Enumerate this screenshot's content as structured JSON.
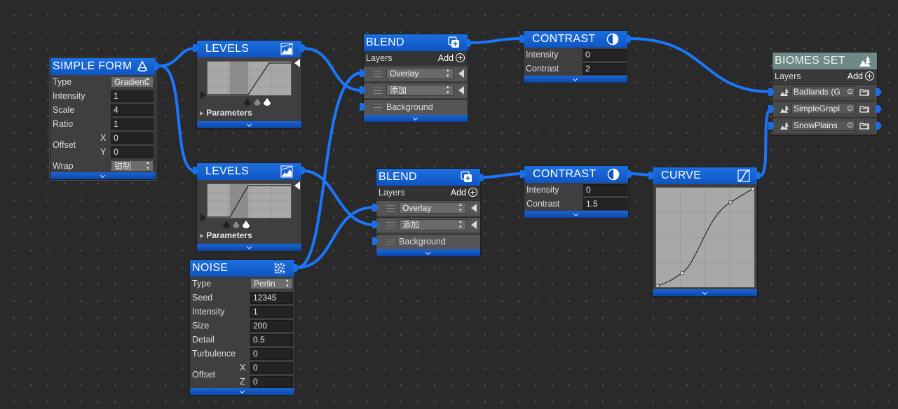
{
  "nodes": {
    "simple_form": {
      "title": "SIMPLE FORM",
      "type_label": "Type",
      "type_value": "Gradient",
      "intensity_label": "Intensity",
      "intensity_value": "1",
      "scale_label": "Scale",
      "scale_value": "4",
      "ratio_label": "Ratio",
      "ratio_value": "1",
      "offset_label": "Offset",
      "x_label": "X",
      "x_value": "0",
      "y_label": "Y",
      "y_value": "0",
      "wrap_label": "Wrap",
      "wrap_value": "钳制"
    },
    "levels_top": {
      "title": "LEVELS",
      "params_label": "Parameters"
    },
    "levels_bottom": {
      "title": "LEVELS",
      "params_label": "Parameters"
    },
    "noise": {
      "title": "NOISE",
      "type_label": "Type",
      "type_value": "Perlin",
      "seed_label": "Seed",
      "seed_value": "12345",
      "intensity_label": "Intensity",
      "intensity_value": "1",
      "size_label": "Size",
      "size_value": "200",
      "detail_label": "Detail",
      "detail_value": "0.5",
      "turbulence_label": "Turbulence",
      "turbulence_value": "0",
      "offset_label": "Offset",
      "x_label": "X",
      "x_value": "0",
      "z_label": "Z",
      "z_value": "0"
    },
    "blend_top": {
      "title": "BLEND",
      "layers_label": "Layers",
      "add_label": "Add",
      "layer1": "Overlay",
      "layer2": "添加",
      "background": "Background"
    },
    "blend_bottom": {
      "title": "BLEND",
      "layers_label": "Layers",
      "add_label": "Add",
      "layer1": "Overlay",
      "layer2": "添加",
      "background": "Background"
    },
    "contrast_top": {
      "title": "CONTRAST",
      "intensity_label": "Intensity",
      "intensity_value": "0",
      "contrast_label": "Contrast",
      "contrast_value": "2"
    },
    "contrast_bottom": {
      "title": "CONTRAST",
      "intensity_label": "Intensity",
      "intensity_value": "0",
      "contrast_label": "Contrast",
      "contrast_value": "1.5"
    },
    "curve": {
      "title": "CURVE"
    },
    "biomes_set": {
      "title": "BIOMES SET",
      "layers_label": "Layers",
      "add_label": "Add",
      "biomes": [
        "Badlands (G",
        "SimpleGrapl",
        "SnowPlains"
      ]
    }
  },
  "colors": {
    "accent": "#1a6fe6",
    "wire": "#1a78ff",
    "biome_header": "#6f8a86"
  }
}
